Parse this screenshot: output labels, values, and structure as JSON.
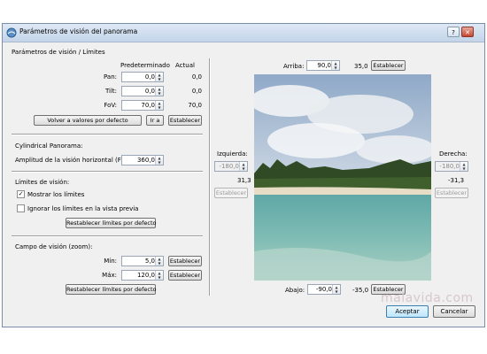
{
  "window": {
    "title": "Parámetros de visión del panorama"
  },
  "view_group": {
    "title": "Parámetros de visión / Límites",
    "col_default": "Predeterminado",
    "col_current": "Actual",
    "rows": [
      {
        "label": "Pan:",
        "value": "0,0",
        "current": "0,0"
      },
      {
        "label": "Tilt:",
        "value": "0,0",
        "current": "0,0"
      },
      {
        "label": "FoV:",
        "value": "70,0",
        "current": "70,0"
      }
    ],
    "reset_label": "Volver a valores por defecto",
    "goto_label": "Ir a",
    "set_label": "Establecer"
  },
  "cyl": {
    "title": "Cylindrical Panorama:",
    "fov_label": "Amplitud de la visión horizontal (FOV):",
    "fov_value": "360,0"
  },
  "limits": {
    "title": "Límites de visión:",
    "show_label": "Mostrar los límites",
    "show_checked": true,
    "ignore_label": "Ignorar los límites en la vista previa",
    "ignore_checked": false,
    "reset_label": "Restablecer límites por defecto"
  },
  "zoom": {
    "title": "Campo de visión (zoom):",
    "min_label": "Mín:",
    "min_value": "5,0",
    "max_label": "Máx:",
    "max_value": "120,0",
    "set_label": "Establecer",
    "reset_label": "Restablecer límites por defecto"
  },
  "preview": {
    "top_label": "Arriba:",
    "top_value": "90,0",
    "top_current": "35,0",
    "bottom_label": "Abajo:",
    "bottom_value": "-90,0",
    "bottom_current": "-35,0",
    "left_label": "Izquierda:",
    "left_value": "-180,0",
    "left_current": "31,3",
    "right_label": "Derecha:",
    "right_value": "-180,0",
    "right_current": "-31,3",
    "set_label": "Establecer"
  },
  "footer": {
    "accept_label": "Aceptar",
    "cancel_label": "Cancelar"
  },
  "watermark": "malavida.com"
}
